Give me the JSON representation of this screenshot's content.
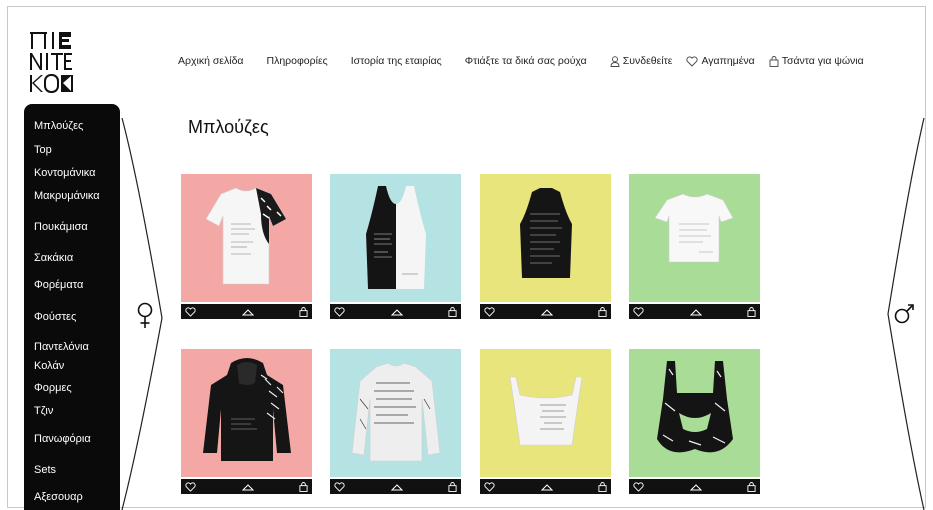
{
  "brand": {
    "logo_lines": [
      "ΠΙΕ",
      "ΝΙΤΕ",
      "ΚΟΚ"
    ]
  },
  "nav": {
    "home": "Αρχική σελίδα",
    "info": "Πληροφορίες",
    "history": "Ιστορία της εταιρίας",
    "make": "Φτιάξτε τα δικά σας ρούχα",
    "login": "Συνδεθείτε",
    "favorites": "Αγαπημένα",
    "bag": "Τσάντα για ψώνια"
  },
  "sidebar": {
    "categories": [
      "Μπλούζες",
      "Top",
      "Κοντομάνικα",
      "Μακρυμάνικα",
      "Πουκάμισα",
      "Σακάκια",
      "Φορέματα",
      "Φούστες",
      "Παντελόνια",
      "Κολάν",
      "Φορμες",
      "Τζιν",
      "Πανωφόρια",
      "Sets",
      "Αξεσουαρ"
    ]
  },
  "page": {
    "title": "Μπλούζες"
  },
  "gender": {
    "left": "female-symbol",
    "right": "male-symbol"
  },
  "products": [
    {
      "bg": "#f4a8a6",
      "item": "white-tshirt"
    },
    {
      "bg": "#b5e2e2",
      "item": "black-white-tank"
    },
    {
      "bg": "#e8e57d",
      "item": "black-crop-top"
    },
    {
      "bg": "#a9dc96",
      "item": "white-crop-tee"
    },
    {
      "bg": "#f4a8a6",
      "item": "black-hoodie"
    },
    {
      "bg": "#b5e2e2",
      "item": "white-sweatshirt"
    },
    {
      "bg": "#e8e57d",
      "item": "white-bustier"
    },
    {
      "bg": "#a9dc96",
      "item": "black-cutout-top"
    }
  ],
  "icons": {
    "card_actions": [
      "heart-icon",
      "hanger-icon",
      "bag-icon"
    ]
  }
}
